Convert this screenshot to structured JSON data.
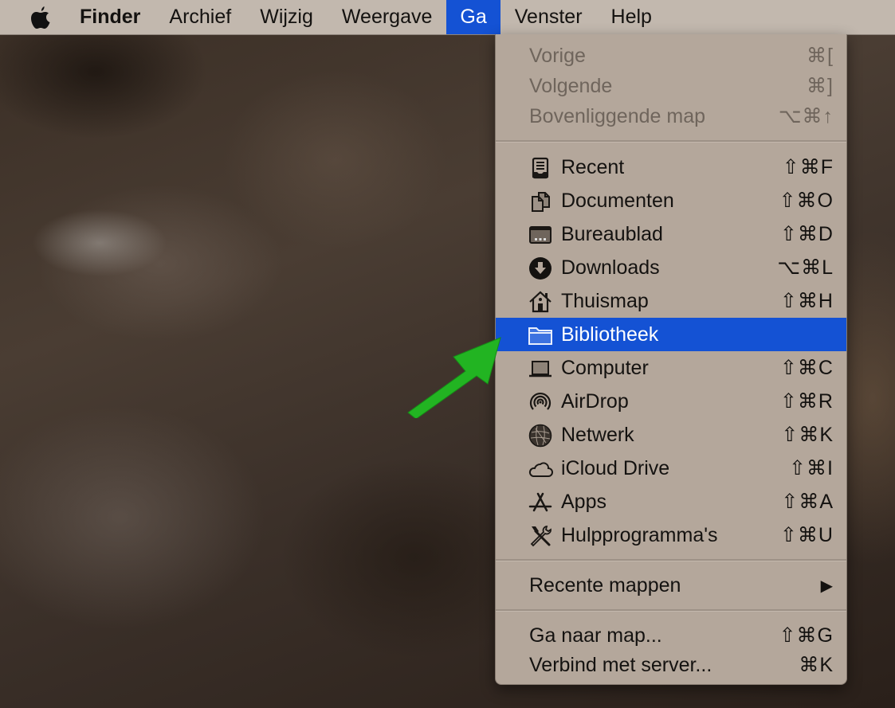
{
  "menubar": {
    "apple_icon": "apple-logo-icon",
    "items": [
      {
        "label": "Finder",
        "bold": true
      },
      {
        "label": "Archief"
      },
      {
        "label": "Wijzig"
      },
      {
        "label": "Weergave"
      },
      {
        "label": "Ga",
        "active": true
      },
      {
        "label": "Venster"
      },
      {
        "label": "Help"
      }
    ]
  },
  "go_menu": {
    "section_history": [
      {
        "label": "Vorige",
        "shortcut": "⌘[",
        "disabled": true
      },
      {
        "label": "Volgende",
        "shortcut": "⌘]",
        "disabled": true
      },
      {
        "label": "Bovenliggende map",
        "shortcut": "⌥⌘↑",
        "disabled": true
      }
    ],
    "section_places": [
      {
        "label": "Recent",
        "shortcut": "⇧⌘F",
        "icon": "recent-tray-icon"
      },
      {
        "label": "Documenten",
        "shortcut": "⇧⌘O",
        "icon": "documents-icon"
      },
      {
        "label": "Bureaublad",
        "shortcut": "⇧⌘D",
        "icon": "desktop-icon"
      },
      {
        "label": "Downloads",
        "shortcut": "⌥⌘L",
        "icon": "download-icon"
      },
      {
        "label": "Thuismap",
        "shortcut": "⇧⌘H",
        "icon": "home-icon"
      },
      {
        "label": "Bibliotheek",
        "shortcut": "",
        "icon": "folder-icon",
        "selected": true
      },
      {
        "label": "Computer",
        "shortcut": "⇧⌘C",
        "icon": "computer-icon"
      },
      {
        "label": "AirDrop",
        "shortcut": "⇧⌘R",
        "icon": "airdrop-icon"
      },
      {
        "label": "Netwerk",
        "shortcut": "⇧⌘K",
        "icon": "network-globe-icon"
      },
      {
        "label": "iCloud Drive",
        "shortcut": "⇧⌘I",
        "icon": "cloud-icon"
      },
      {
        "label": "Apps",
        "shortcut": "⇧⌘A",
        "icon": "apps-icon"
      },
      {
        "label": "Hulpprogramma's",
        "shortcut": "⇧⌘U",
        "icon": "utilities-tools-icon"
      }
    ],
    "section_recent": [
      {
        "label": "Recente mappen",
        "submenu_indicator": "▶"
      }
    ],
    "section_connect": [
      {
        "label": "Ga naar map...",
        "shortcut": "⇧⌘G"
      },
      {
        "label": "Verbind met server...",
        "shortcut": "⌘K"
      }
    ]
  },
  "annotation": {
    "arrow_color": "#22b422",
    "points_to": "Bibliotheek"
  },
  "colors": {
    "highlight": "#1452d4",
    "menu_bg": "#b4a79b",
    "menubar_bg": "#c2b8ae"
  }
}
